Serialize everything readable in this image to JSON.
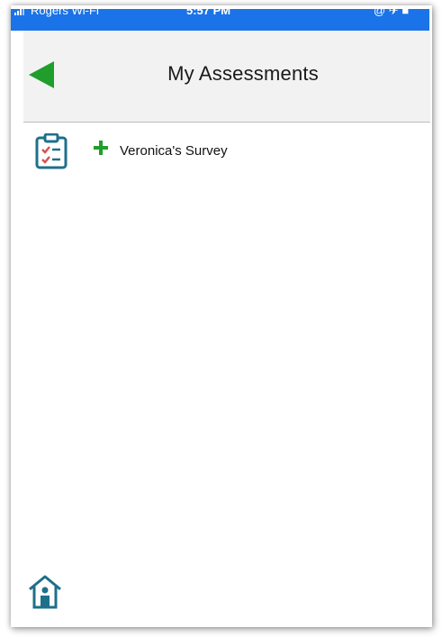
{
  "status_bar": {
    "carrier": "Rogers Wi-Fi",
    "time": "5:57 PM",
    "right": "@ ✈ ■"
  },
  "header": {
    "title": "My Assessments",
    "back_icon": "back-arrow-icon"
  },
  "assessments": [
    {
      "label": "Veronica's Survey",
      "icon": "clipboard-checklist-icon",
      "action_icon": "plus-icon"
    }
  ],
  "footer": {
    "home_icon": "home-icon"
  },
  "colors": {
    "status_bar_bg": "#1a73e8",
    "header_bg": "#f2f2f2",
    "accent_green": "#1f9e2c",
    "icon_teal": "#1f6f8b",
    "check_red": "#d9534f"
  }
}
